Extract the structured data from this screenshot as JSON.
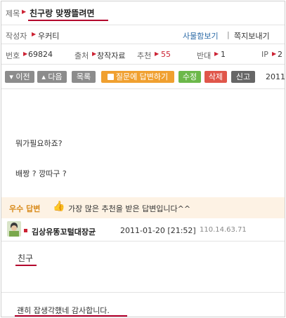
{
  "post": {
    "title_label": "제목",
    "title": "친구랑 맞짱뜰려면",
    "author_label": "작성자",
    "author": "우커티",
    "profile_link": "사물함보기",
    "message_link": "쪽지보내기",
    "number_label": "번호",
    "number": "69824",
    "source_label": "출처",
    "source": "창작자료",
    "recommend_label": "추천",
    "recommend": "55",
    "oppose_label": "반대",
    "oppose": "1",
    "ip_label": "IP",
    "ip": "2",
    "body_line1": "뭐가필요하죠?",
    "body_line2": "배짱 ? 깡따구 ?"
  },
  "toolbar": {
    "prev": "▾ 이전",
    "next": "▴ 다음",
    "list": "목록",
    "answer": "질문에 답변하기",
    "edit": "수정",
    "delete": "삭제",
    "report": "신고",
    "date": "2011"
  },
  "best_answer": {
    "label": "우수 답변",
    "description": "가장 많은 추천을 받은 답변입니다^^",
    "author": "김상유똥꼬털대장균",
    "datetime": "2011-01-20 [21:52]",
    "ip": "110.14.63.71",
    "body": "친구"
  },
  "comment": {
    "text": "괜히 잡생각했네 감사합니다."
  },
  "colors": {
    "accent": "#b4002d",
    "btn_gray": "#8c8c8c",
    "btn_orange": "#f0a030",
    "btn_green": "#6cb84a",
    "btn_red": "#e0564a",
    "btn_dark": "#666666",
    "link": "#2b6aa6",
    "highlight_bg": "#fdf2e4"
  }
}
